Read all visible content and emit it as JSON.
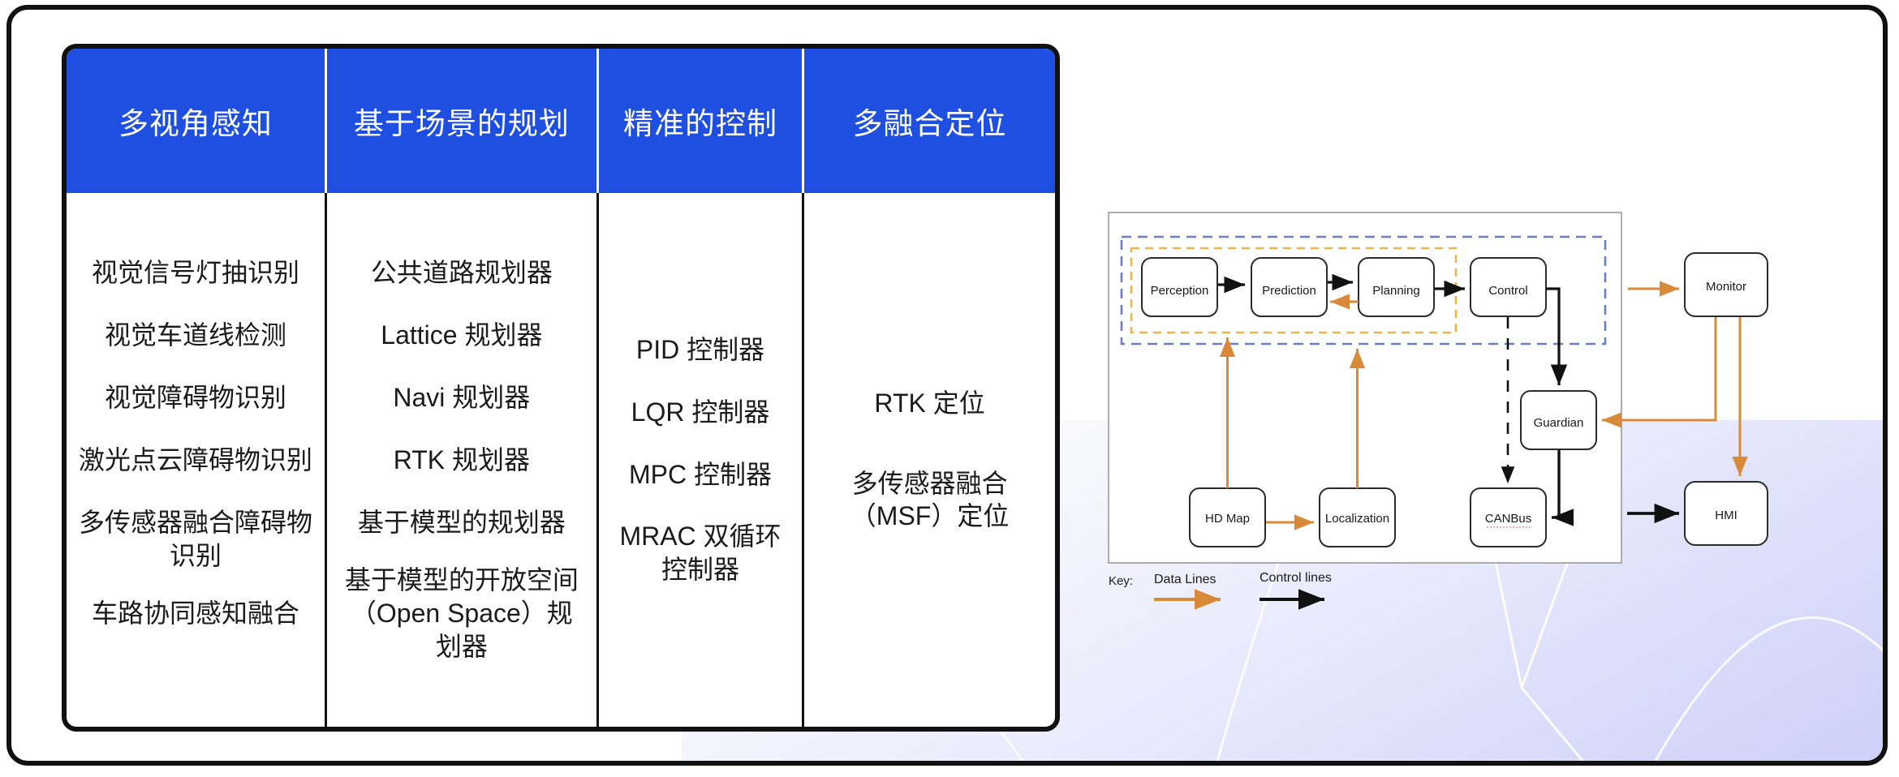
{
  "table": {
    "headers": [
      "多视角感知",
      "基于场景的规划",
      "精准的控制",
      "多融合定位"
    ],
    "columns": [
      {
        "header": "多视角感知",
        "items": [
          "视觉信号灯抽识别",
          "视觉车道线检测",
          "视觉障碍物识别",
          "激光点云障碍物识别",
          "多传感器融合障碍物识别",
          "车路协同感知融合"
        ]
      },
      {
        "header": "基于场景的规划",
        "items": [
          "公共道路规划器",
          "Lattice 规划器",
          "Navi 规划器",
          "RTK 规划器",
          "基于模型的规划器",
          "基于模型的开放空间（Open Space）规划器"
        ]
      },
      {
        "header": "精准的控制",
        "items": [
          "PID 控制器",
          "LQR 控制器",
          "MPC 控制器",
          "MRAC 双循环控制器"
        ]
      },
      {
        "header": "多融合定位",
        "items": [
          "RTK 定位",
          "多传感器融合（MSF）定位"
        ]
      }
    ]
  },
  "diagram": {
    "nodes": {
      "perception": "Perception",
      "prediction": "Prediction",
      "planning": "Planning",
      "control": "Control",
      "guardian": "Guardian",
      "canbus": "CANBus",
      "hd_map": "HD Map",
      "localization": "Localization",
      "monitor": "Monitor",
      "hmi": "HMI"
    },
    "key": {
      "label": "Key:",
      "data_lines": "Data Lines",
      "control_lines": "Control lines"
    }
  },
  "colors": {
    "header_blue": "#1f4fe0",
    "frame_black": "#111111",
    "data_line_orange": "#d98a38",
    "control_line_black": "#111111",
    "dashed_blue": "#6b7fc4",
    "dashed_orange": "#e8b64c",
    "wash_lavender": "#babef6"
  }
}
